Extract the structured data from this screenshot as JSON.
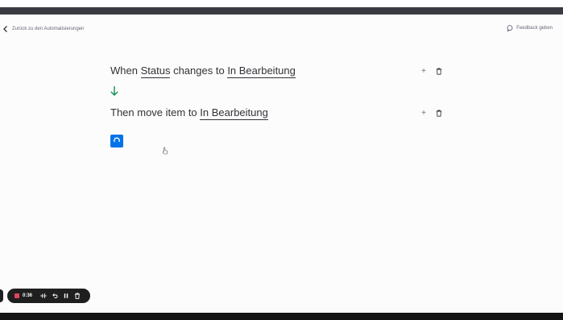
{
  "header": {
    "back_label": "Zurück zu den Automatisierungen",
    "feedback_label": "Feedback geben"
  },
  "rule": {
    "trigger": {
      "prefix": "When",
      "field": "Status",
      "middle": "changes to",
      "value": "In Bearbeitung"
    },
    "action": {
      "prefix": "Then move item to",
      "value": "In Bearbeitung"
    }
  },
  "recorder": {
    "time": "0:36"
  },
  "colors": {
    "accent_blue": "#0073ea",
    "arrow_green": "#00854d",
    "record_red": "#e2445c"
  },
  "icons": {
    "back": "chevron-left-icon",
    "feedback": "speech-bubble-icon",
    "arrow": "arrow-down-icon",
    "add": "plus-icon",
    "delete": "trash-icon",
    "loading": "spinner-icon"
  }
}
